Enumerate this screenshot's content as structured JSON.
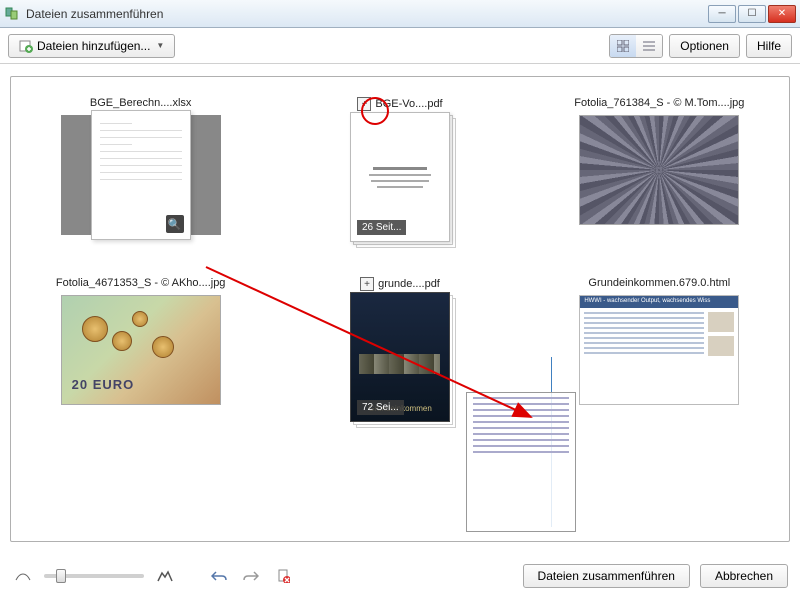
{
  "window": {
    "title": "Dateien zusammenführen"
  },
  "toolbar": {
    "add_files": "Dateien hinzufügen...",
    "options": "Optionen",
    "help": "Hilfe"
  },
  "items": [
    {
      "title": "BGE_Berechn....xlsx",
      "type": "spreadsheet",
      "selected": true
    },
    {
      "title": "BGE-Vo....pdf",
      "type": "pdf",
      "pages": "26 Seit...",
      "expandable": true
    },
    {
      "title": "Fotolia_761384_S - © M.Tom....jpg",
      "type": "image_crowd"
    },
    {
      "title": "Fotolia_4671353_S - © AKho....jpg",
      "type": "image_money"
    },
    {
      "title": "grunde....pdf",
      "type": "pdf_dark",
      "pages": "72 Sei...",
      "cover_text": "Grundeinkommen",
      "expandable": true
    },
    {
      "title": "Grundeinkommen.679.0.html",
      "type": "html",
      "header": "HWWI - wachsender Output, wachsendes Wiss"
    }
  ],
  "footer": {
    "merge": "Dateien zusammenführen",
    "cancel": "Abbrechen"
  }
}
